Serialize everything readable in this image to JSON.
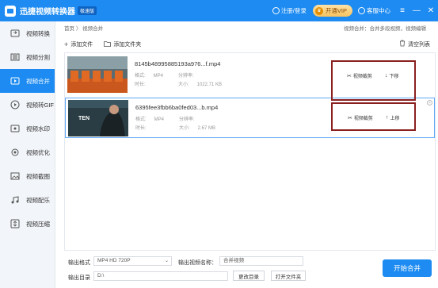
{
  "app": {
    "title": "迅捷视频转换器",
    "badge": "极速版"
  },
  "titlebar": {
    "login": "注册/登录",
    "vip": "开通VIP",
    "support": "客服中心",
    "controls": [
      "≡",
      "—",
      "✕"
    ]
  },
  "sidebar": {
    "items": [
      {
        "label": "视频转换",
        "icon": "video-convert-icon"
      },
      {
        "label": "视频分割",
        "icon": "video-split-icon"
      },
      {
        "label": "视频合并",
        "icon": "video-merge-icon",
        "active": true
      },
      {
        "label": "视频转GIF",
        "icon": "gif-icon"
      },
      {
        "label": "视频水印",
        "icon": "watermark-icon"
      },
      {
        "label": "视频优化",
        "icon": "optimize-icon"
      },
      {
        "label": "视频截图",
        "icon": "screenshot-icon"
      },
      {
        "label": "视频配乐",
        "icon": "music-icon"
      },
      {
        "label": "视频压缩",
        "icon": "compress-icon"
      }
    ]
  },
  "breadcrumb": {
    "home": "首页",
    "sep": "〉",
    "current": "视频合并"
  },
  "merge_tip": "视频合并：合并多段视频，视频编辑",
  "toolbar": {
    "add_file": "添加文件",
    "add_folder": "添加文件夹",
    "clear_list": "清空列表"
  },
  "files": [
    {
      "name": "8145b48995885193a976...f.mp4",
      "format_label": "格式:",
      "format": "MP4",
      "duration_label": "分辨率:",
      "duration": "",
      "time_label": "时长:",
      "time": "",
      "size_label": "大小:",
      "size": "1022.71 KB",
      "edit": "视频裁剪",
      "move": "下移",
      "move_arrow": "↓"
    },
    {
      "name": "6395fee3fbb6ba0fed03...b.mp4",
      "format_label": "格式:",
      "format": "MP4",
      "duration_label": "分辨率:",
      "duration": "",
      "time_label": "时长:",
      "time": "",
      "size_label": "大小:",
      "size": "2.67 MB",
      "edit": "视频裁剪",
      "move": "上移",
      "move_arrow": "↑",
      "thumb_text": "TEN"
    }
  ],
  "bottom": {
    "format_label": "输出格式",
    "format_value": "MP4  HD 720P",
    "name_label": "输出视频名称：",
    "name_value": "合并视频",
    "dir_label": "输出目录",
    "dir_value": "D:\\",
    "change_dir": "更改目录",
    "open_folder": "打开文件夹",
    "start": "开始合并"
  },
  "colors": {
    "accent": "#1d8bf1",
    "highlight": "#8a1f1f",
    "vip": "#f6c25f"
  }
}
